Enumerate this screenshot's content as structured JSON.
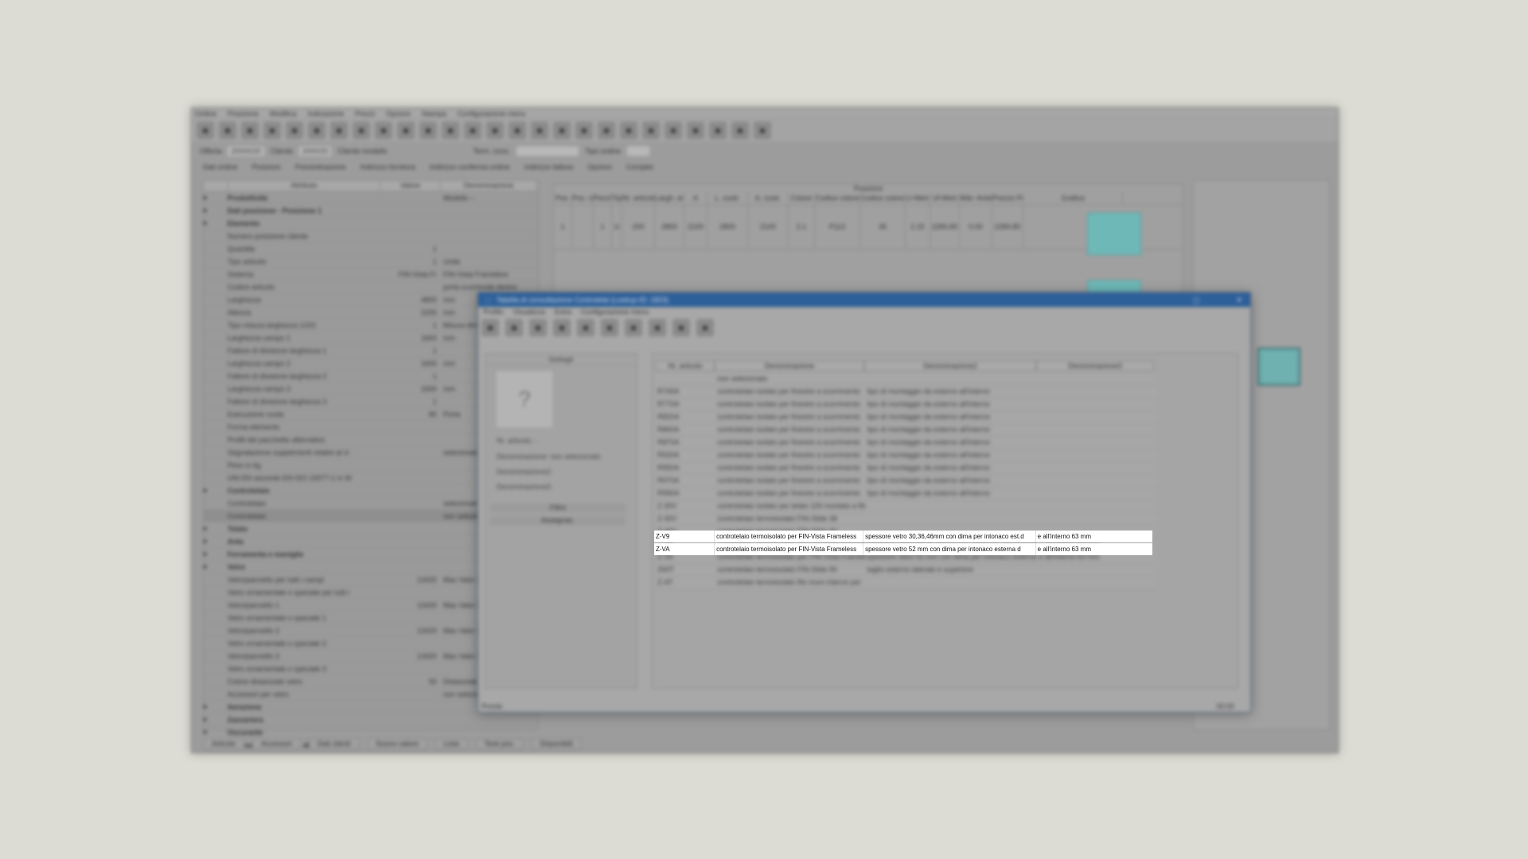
{
  "main": {
    "menu": [
      "Ordine",
      "Posizione",
      "Modifica",
      "Indicazione",
      "Prezzi",
      "Opzioni",
      "Stampa",
      "Configurazione menu"
    ],
    "toolbar_icons": [
      "new-icon",
      "delete-icon",
      "save-icon",
      "users-icon",
      "group-icon",
      "refresh-icon",
      "document-icon",
      "print-icon",
      "pdf-icon",
      "tree-icon",
      "edit-icon",
      "move-icon",
      "arrows-icon",
      "split-icon",
      "merge-icon",
      "copy-icon",
      "paste-icon",
      "disk-icon",
      "globe-icon",
      "tools-icon",
      "pencil-icon",
      "info-icon",
      "sync-icon",
      "people-icon",
      "filter-icon",
      "export-icon"
    ],
    "info": {
      "offerta_label": "Offerta",
      "offerta_value": "20000/20",
      "cliente_label": "Cliente",
      "cliente_value": "2000/20",
      "cliente_name": "Cliente modello",
      "term_label": "Term. cons.",
      "tipo_label": "Tipo ordine"
    },
    "tabs": [
      "Dati ordine",
      "Posizioni",
      "Preventivazione",
      "Indirizzo fornitura",
      "Indirizzo conferma ordine",
      "Indirizzo fattura",
      "Opzioni",
      "Complet."
    ],
    "attr_headers": [
      "Attributo",
      "Valore",
      "Denominazione"
    ],
    "attr_rows": [
      {
        "name": "Produttività",
        "value": "",
        "desc": "Modello --",
        "group": true
      },
      {
        "name": "Dati posizione - Posizione 1",
        "value": "",
        "desc": "",
        "group": true
      },
      {
        "name": "Elemento",
        "value": "",
        "desc": "",
        "group": true
      },
      {
        "name": "Numero posizione cliente",
        "value": "",
        "desc": ""
      },
      {
        "name": "Quantità",
        "value": "1",
        "desc": ""
      },
      {
        "name": "Tipo articolo",
        "value": "1",
        "desc": "Unità"
      },
      {
        "name": "Sistema",
        "value": "FIN-Vista Fr",
        "desc": "FIN-Vista Frameless"
      },
      {
        "name": "Codice articolo",
        "value": "",
        "desc": "porta scorrevole destra"
      },
      {
        "name": "Larghezza",
        "value": "4800",
        "desc": "mm"
      },
      {
        "name": "Altezza",
        "value": "2200",
        "desc": "mm"
      },
      {
        "name": "Tipo misura larghezza 1/2/3",
        "value": "1",
        "desc": "Misura dimensione"
      },
      {
        "name": "Larghezza campo 1",
        "value": "1600",
        "desc": "mm"
      },
      {
        "name": "Fattore di divisione larghezza 1",
        "value": "1",
        "desc": ""
      },
      {
        "name": "Larghezza campo 2",
        "value": "1600",
        "desc": "mm"
      },
      {
        "name": "Fattore di divisione larghezza 2",
        "value": "1",
        "desc": ""
      },
      {
        "name": "Larghezza campo 3",
        "value": "1600",
        "desc": "mm"
      },
      {
        "name": "Fattore di divisione larghezza 3",
        "value": "1",
        "desc": ""
      },
      {
        "name": "Esecuzione vuote",
        "value": "80",
        "desc": "Porta"
      },
      {
        "name": "Forma elemento",
        "value": "",
        "desc": ""
      },
      {
        "name": "Profili del pacchetto alternativo",
        "value": "",
        "desc": ""
      },
      {
        "name": "Segnalazione supplementi relativi al vi",
        "value": "",
        "desc": "selezionato"
      },
      {
        "name": "Peso in kg",
        "value": "",
        "desc": ""
      },
      {
        "name": "UNI EN secondo EN ISO 10077-1 in W",
        "value": "",
        "desc": ""
      },
      {
        "name": "Controtelaio",
        "value": "",
        "desc": "",
        "group": true
      },
      {
        "name": "Controtelaio",
        "value": "",
        "desc": "selezionato"
      },
      {
        "name": "Controtelaio",
        "value": "",
        "desc": "non selezionato",
        "sel": true
      },
      {
        "name": "Telaio",
        "value": "",
        "desc": "",
        "group": true
      },
      {
        "name": "Anta",
        "value": "",
        "desc": "",
        "group": true
      },
      {
        "name": "Ferramenta e maniglie",
        "value": "",
        "desc": "",
        "group": true
      },
      {
        "name": "Vetro",
        "value": "",
        "desc": "",
        "group": true
      },
      {
        "name": "Vetro/pannello per tutti i campi",
        "value": "13420",
        "desc": "Max Valor 3 con Pla"
      },
      {
        "name": "Vetro ornamentale o speciale per tutti i",
        "value": "",
        "desc": ""
      },
      {
        "name": "Vetro/pannello 1",
        "value": "13420",
        "desc": "Max Valor 3 con Pla"
      },
      {
        "name": "Vetro ornamentale o speciale 1",
        "value": "",
        "desc": ""
      },
      {
        "name": "Vetro/pannello 2",
        "value": "13420",
        "desc": "Max Valor 3 con Pla"
      },
      {
        "name": "Vetro ornamentale o speciale 2",
        "value": "",
        "desc": ""
      },
      {
        "name": "Vetro/pannello 3",
        "value": "13420",
        "desc": "Max Valor 3 con Pla"
      },
      {
        "name": "Vetro ornamentale o speciale 3",
        "value": "",
        "desc": ""
      },
      {
        "name": "Colore distanziale vetro",
        "value": "50",
        "desc": "Distanziale termico"
      },
      {
        "name": "Accessori per vetro",
        "value": "",
        "desc": "non selezionato"
      },
      {
        "name": "Aerazione",
        "value": "",
        "desc": "",
        "group": true
      },
      {
        "name": "Zanzariera",
        "value": "",
        "desc": "",
        "group": true
      },
      {
        "name": "Oscurante",
        "value": "",
        "desc": "",
        "group": true
      },
      {
        "name": "Accessori e materiale di montaggio",
        "value": "",
        "desc": "",
        "group": true
      }
    ],
    "pos_headers": [
      "Pos.",
      "Pos. cl.",
      "Pezzi",
      "Tipo",
      "Nr. articolo",
      "Largh. el.",
      "A",
      "L. costr.",
      "A. costr.",
      "Colore",
      "Codice colore",
      "Codice colore",
      "U-Wert",
      "Uf-Wert",
      "Wär.-Anteil",
      "Prezzo Pos.",
      "Grafica"
    ],
    "pos_row": [
      "1",
      "",
      "1",
      "U",
      "200",
      "2800",
      "2100",
      "2800",
      "2100",
      "2.1",
      "P113",
      "45",
      "2.15",
      "2284.80",
      "0.00",
      "2284.80"
    ],
    "pos_panel_title": "Posizioni",
    "bottom_tabs": [
      "Articolo",
      "Accessori",
      "Dati clienti",
      "Nuovo valore",
      "Lista",
      "Testi pos.",
      "Disponibili"
    ]
  },
  "dialog": {
    "title": "Tabella di consultazione Controtelai (Lookup-ID: 1823)",
    "menu": [
      "Profilo",
      "Visualizza",
      "Extra",
      "Configurazione menu"
    ],
    "toolbar_icons": [
      "new-icon",
      "delete-icon",
      "table-icon",
      "image-icon",
      "filter-icon",
      "save-icon",
      "refresh-icon",
      "pencil-icon",
      "star-icon",
      "export-icon"
    ],
    "detail_title": "Dettagli",
    "detail_lines": [
      "Nr. articolo: -",
      "Denominazione: non selezionato",
      "Denominazione2:",
      "Denominazione3:"
    ],
    "detail_sections": [
      "Filtro",
      "Assegnaz."
    ],
    "columns": [
      "Nr. articolo",
      "Denominazione",
      "Denominazione2",
      "Denominazione3"
    ],
    "rows": [
      [
        "",
        "non selezionato",
        "",
        ""
      ],
      [
        "R740A",
        "controtelaio isolato per finestre a scorrimento",
        "tipo di montaggio da esterno all'interno",
        ""
      ],
      [
        "R770A",
        "controtelaio isolato per finestre a scorrimento",
        "tipo di montaggio da esterno all'interno",
        ""
      ],
      [
        "R820A",
        "controtelaio isolato per finestre a scorrimento",
        "tipo di montaggio da esterno all'interno",
        ""
      ],
      [
        "R860A",
        "controtelaio isolato per finestre a scorrimento",
        "tipo di montaggio da esterno all'interno",
        ""
      ],
      [
        "R870A",
        "controtelaio isolato per finestre a scorrimento",
        "tipo di montaggio da esterno all'interno",
        ""
      ],
      [
        "R920A",
        "controtelaio isolato per finestre a scorrimento",
        "tipo di montaggio da esterno all'interno",
        ""
      ],
      [
        "R950A",
        "controtelaio isolato per finestre a scorrimento",
        "tipo di montaggio da esterno all'interno",
        ""
      ],
      [
        "R970A",
        "controtelaio isolato per finestre a scorrimento",
        "tipo di montaggio da esterno all'interno",
        ""
      ],
      [
        "R990A",
        "controtelaio isolato per finestre a scorrimento",
        "tipo di montaggio da esterno all'interno",
        ""
      ],
      [
        "Z-30V",
        "controtelaio isolato per telaio 100 montato a filo",
        "",
        ""
      ],
      [
        "Z-30V",
        "controtelaio termoisolato FIN-Slide 38",
        "",
        ""
      ],
      [
        "Z-40V",
        "controtelaio termoisolato FIN-Slide 90",
        "",
        ""
      ],
      [
        "Z-V9",
        "controtelaio termoisolato per FIN-Vista Frameless",
        "spessore vetro 30,36,46mm con dima per intonaco est.d",
        "e all'interno 63 mm"
      ],
      [
        "Z-VA",
        "controtelaio termoisolato per FIN-Vista Frameless",
        "spessore vetro 52 mm con dima per intonaco esterna d",
        "e all'interno 63 mm"
      ],
      [
        "Z60T",
        "controtelaio termoisolato FIN-Slide 90",
        "taglio esterno laterale e superiore",
        ""
      ],
      [
        "Z-AT",
        "controtelaio termoisolato filo muro interno per",
        "",
        ""
      ]
    ],
    "status": "Pronto",
    "status_right": "00:00"
  }
}
